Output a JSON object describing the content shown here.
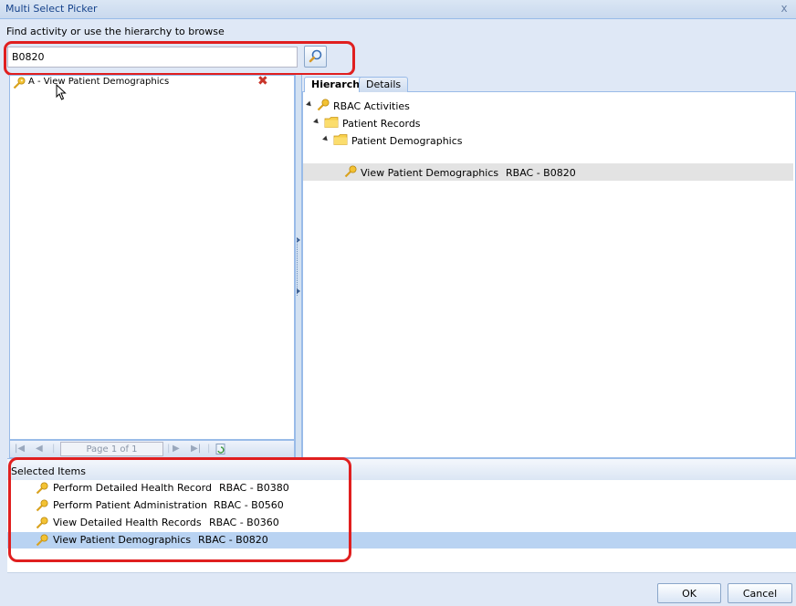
{
  "window": {
    "title": "Multi Select Picker",
    "close_glyph": "x"
  },
  "search": {
    "prompt": "Find activity or use the hierarchy to browse",
    "value": "B0820",
    "button_icon": "search-icon"
  },
  "results": [
    {
      "label": "A - View Patient Demographics",
      "icon": "key-icon"
    }
  ],
  "pager": {
    "page_info": "Page 1 of 1"
  },
  "tabs": [
    {
      "label": "Hierarchy",
      "active": true
    },
    {
      "label": "Details",
      "active": false
    }
  ],
  "tree": [
    {
      "label": "RBAC Activities",
      "icon": "key-icon",
      "level": 0,
      "expanded": true
    },
    {
      "label": "Patient Records",
      "icon": "folder-icon",
      "level": 1,
      "expanded": true
    },
    {
      "label": "Patient Demographics",
      "icon": "folder-icon",
      "level": 2,
      "expanded": true
    },
    {
      "label": "View Patient Demographics",
      "code": "RBAC - B0820",
      "icon": "key-icon",
      "level": 3,
      "selected": true
    }
  ],
  "selected_items": {
    "header": "Selected Items",
    "items": [
      {
        "label": "Perform Detailed Health Record",
        "code": "RBAC - B0380"
      },
      {
        "label": "Perform Patient Administration",
        "code": "RBAC - B0560"
      },
      {
        "label": "View Detailed Health Records",
        "code": "RBAC - B0360"
      },
      {
        "label": "View Patient Demographics",
        "code": "RBAC - B0820",
        "selected": true
      }
    ]
  },
  "buttons": {
    "ok": "OK",
    "cancel": "Cancel"
  },
  "colors": {
    "highlight_box": "#e01f1f",
    "selection_row": "#b9d3f2",
    "tree_selection": "#e3e3e3",
    "panel_border": "#99bbe8"
  }
}
